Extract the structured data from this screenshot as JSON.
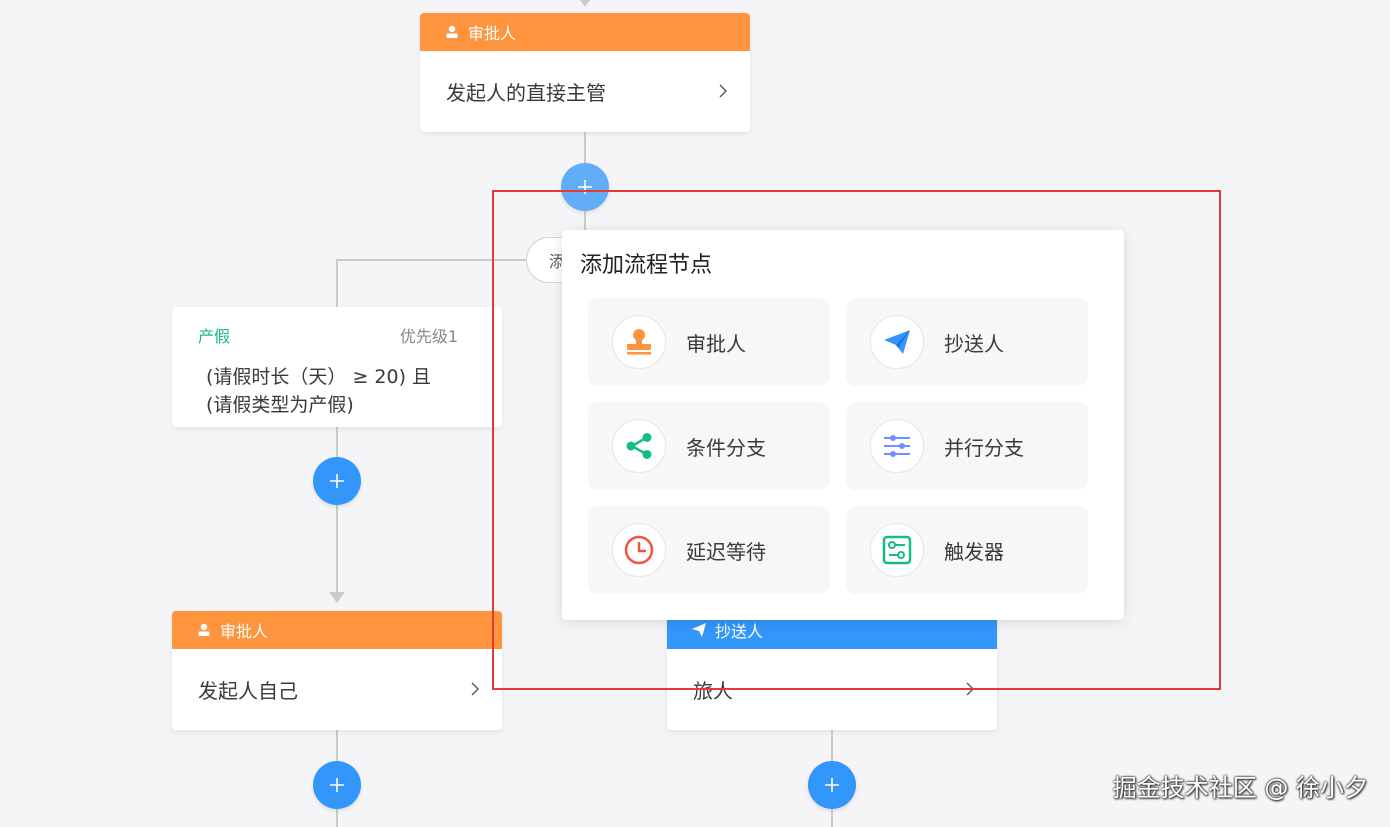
{
  "top_approver": {
    "header": "审批人",
    "body": "发起人的直接主管"
  },
  "condition": {
    "title": "产假",
    "priority": "优先级1",
    "line1": "(请假时长（天） ≥ 20) 且",
    "line2": "(请假类型为产假)"
  },
  "hidden_pill": {
    "text": "添"
  },
  "bottom_left": {
    "header": "审批人",
    "body": "发起人自己"
  },
  "bottom_right": {
    "header": "抄送人",
    "body": "旅人"
  },
  "popover": {
    "title": "添加流程节点",
    "options": [
      {
        "label": "审批人",
        "icon": "stamp-icon",
        "color": "#ff943e"
      },
      {
        "label": "抄送人",
        "icon": "send-icon",
        "color": "#3296fa"
      },
      {
        "label": "条件分支",
        "icon": "share-icon",
        "color": "#15bc83"
      },
      {
        "label": "并行分支",
        "icon": "parallel-icon",
        "color": "#718dff"
      },
      {
        "label": "延迟等待",
        "icon": "clock-icon",
        "color": "#f25643"
      },
      {
        "label": "触发器",
        "icon": "trigger-icon",
        "color": "#15bc83"
      }
    ]
  },
  "watermark": "掘金技术社区 @ 徐小夕",
  "colors": {
    "approver": "#ff943e",
    "cc": "#3296fa",
    "add_button": "#3296fa",
    "condition_title": "#15bc83",
    "highlight": "#e23a3a"
  }
}
